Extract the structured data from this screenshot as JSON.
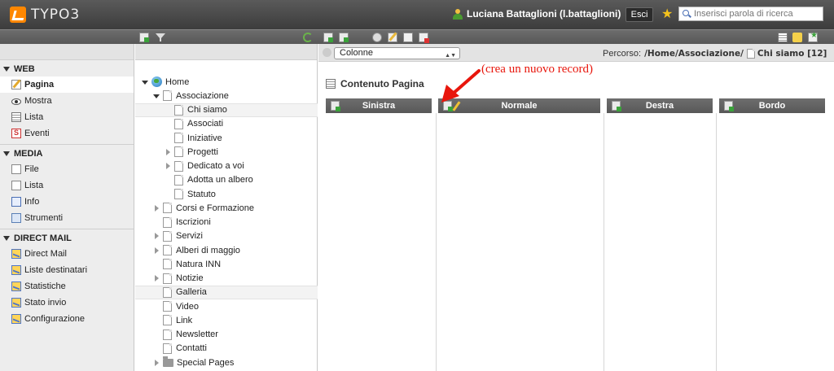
{
  "header": {
    "logo_text": "TYPO3",
    "user_name": "Luciana Battaglioni (l.battaglioni)",
    "logout_label": "Esci",
    "search_placeholder": "Inserisci parola di ricerca"
  },
  "modules": {
    "sections": [
      {
        "title": "WEB",
        "items": [
          {
            "label": "Pagina",
            "icon": "page-edit-icon",
            "active": true
          },
          {
            "label": "Mostra",
            "icon": "eye-icon"
          },
          {
            "label": "Lista",
            "icon": "list-icon"
          },
          {
            "label": "Eventi",
            "icon": "events-icon"
          }
        ]
      },
      {
        "title": "MEDIA",
        "items": [
          {
            "label": "File",
            "icon": "file-icon"
          },
          {
            "label": "Lista",
            "icon": "list-icon"
          },
          {
            "label": "Info",
            "icon": "info-icon"
          },
          {
            "label": "Strumenti",
            "icon": "tools-icon"
          }
        ]
      },
      {
        "title": "DIRECT MAIL",
        "items": [
          {
            "label": "Direct Mail",
            "icon": "mail-icon"
          },
          {
            "label": "Liste destinatari",
            "icon": "mail-icon"
          },
          {
            "label": "Statistiche",
            "icon": "mail-icon"
          },
          {
            "label": "Stato invio",
            "icon": "mail-icon"
          },
          {
            "label": "Configurazione",
            "icon": "mail-icon"
          }
        ]
      }
    ]
  },
  "tree": {
    "nodes": [
      {
        "label": "Home",
        "level": 0,
        "expander": "open",
        "icon": "globe"
      },
      {
        "label": "Associazione",
        "level": 1,
        "expander": "open",
        "icon": "page"
      },
      {
        "label": "Chi siamo",
        "level": 2,
        "expander": "none",
        "icon": "page",
        "selected": true
      },
      {
        "label": "Associati",
        "level": 2,
        "expander": "none",
        "icon": "page"
      },
      {
        "label": "Iniziative",
        "level": 2,
        "expander": "none",
        "icon": "page"
      },
      {
        "label": "Progetti",
        "level": 2,
        "expander": "closed",
        "icon": "page"
      },
      {
        "label": "Dedicato a voi",
        "level": 2,
        "expander": "closed",
        "icon": "page"
      },
      {
        "label": "Adotta un albero",
        "level": 2,
        "expander": "none",
        "icon": "page"
      },
      {
        "label": "Statuto",
        "level": 2,
        "expander": "none",
        "icon": "page"
      },
      {
        "label": "Corsi e Formazione",
        "level": 1,
        "expander": "closed",
        "icon": "page"
      },
      {
        "label": "Iscrizioni",
        "level": 1,
        "expander": "none",
        "icon": "page"
      },
      {
        "label": "Servizi",
        "level": 1,
        "expander": "closed",
        "icon": "page"
      },
      {
        "label": "Alberi di maggio",
        "level": 1,
        "expander": "closed",
        "icon": "page"
      },
      {
        "label": "Natura INN",
        "level": 1,
        "expander": "none",
        "icon": "page"
      },
      {
        "label": "Notizie",
        "level": 1,
        "expander": "closed",
        "icon": "page"
      },
      {
        "label": "Galleria",
        "level": 1,
        "expander": "none",
        "icon": "page",
        "highlight": true
      },
      {
        "label": "Video",
        "level": 1,
        "expander": "none",
        "icon": "page"
      },
      {
        "label": "Link",
        "level": 1,
        "expander": "none",
        "icon": "page"
      },
      {
        "label": "Newsletter",
        "level": 1,
        "expander": "none",
        "icon": "page"
      },
      {
        "label": "Contatti",
        "level": 1,
        "expander": "none",
        "icon": "page"
      },
      {
        "label": "Special Pages",
        "level": 1,
        "expander": "closed",
        "icon": "folder"
      }
    ]
  },
  "content": {
    "view_select": "Colonne",
    "path_label": "Percorso:",
    "path_value": "/Home/Associazione/",
    "page_title": "Chi siamo [12]",
    "heading": "Contenuto Pagina",
    "columns": [
      "Sinistra",
      "Normale",
      "Destra",
      "Bordo"
    ],
    "annotation": "(crea un nuovo record)",
    "annotation_color": "#e8160c"
  }
}
